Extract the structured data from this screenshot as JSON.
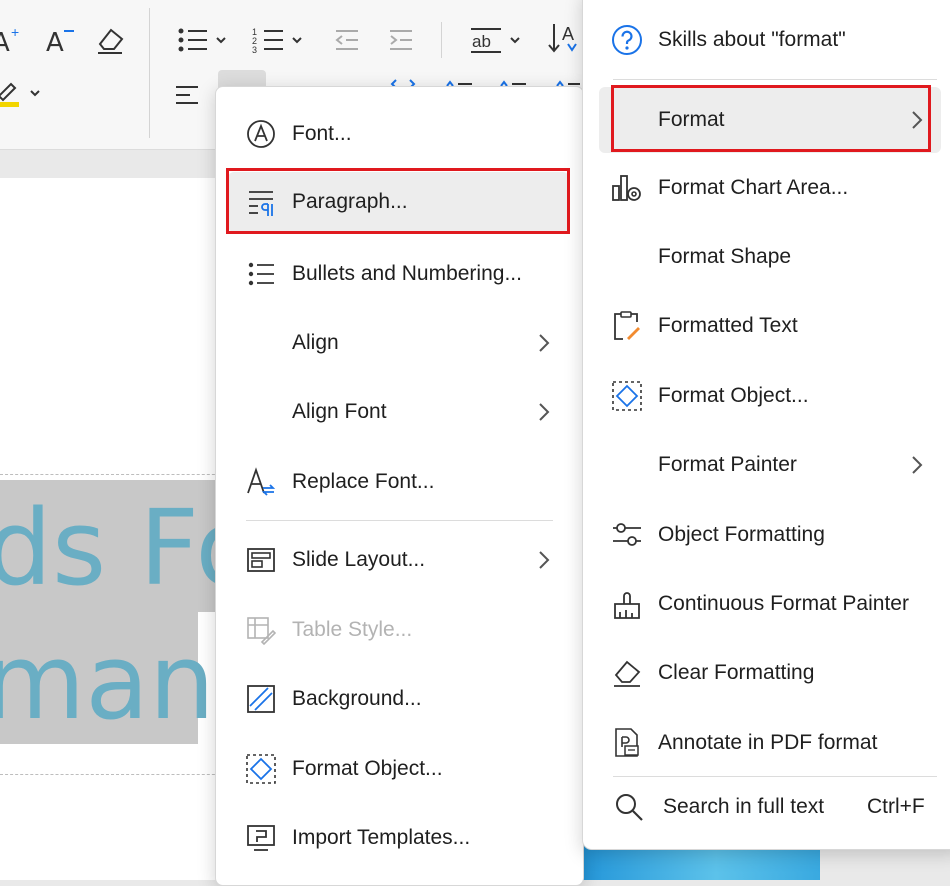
{
  "context_menu": {
    "items": [
      {
        "label": "Font...",
        "icon": "font-circle-icon"
      },
      {
        "label": "Paragraph...",
        "icon": "paragraph-icon",
        "highlighted": true
      },
      {
        "label": "Bullets and Numbering...",
        "icon": "bullets-list-icon"
      },
      {
        "label": "Align",
        "submenu": true
      },
      {
        "label": "Align Font",
        "submenu": true
      },
      {
        "label": "Replace Font...",
        "icon": "replace-font-icon"
      },
      {
        "label": "Slide Layout...",
        "icon": "slide-layout-icon",
        "submenu": true
      },
      {
        "label": "Table Style...",
        "icon": "table-style-icon",
        "disabled": true
      },
      {
        "label": "Background...",
        "icon": "background-icon"
      },
      {
        "label": "Format Object...",
        "icon": "format-object-icon"
      },
      {
        "label": "Import Templates...",
        "icon": "import-templates-icon"
      }
    ]
  },
  "skills_panel": {
    "header": "Skills about \"format\"",
    "items": [
      {
        "label": "Format",
        "submenu": true,
        "highlighted": true
      },
      {
        "label": "Format Chart Area...",
        "icon": "chart-area-icon"
      },
      {
        "label": "Format Shape"
      },
      {
        "label": "Formatted Text",
        "icon": "formatted-text-icon"
      },
      {
        "label": "Format Object...",
        "icon": "format-object-icon"
      },
      {
        "label": "Format Painter",
        "submenu": true
      },
      {
        "label": "Object Formatting",
        "icon": "object-formatting-icon"
      },
      {
        "label": "Continuous Format Painter",
        "icon": "format-painter-icon"
      },
      {
        "label": "Clear Formatting",
        "icon": "eraser-icon"
      },
      {
        "label": "Annotate in PDF format",
        "icon": "pdf-annotate-icon"
      }
    ],
    "search": {
      "label": "Search in full text",
      "shortcut": "Ctrl+F"
    }
  },
  "document": {
    "line1": "ds Fo",
    "line2": "man"
  },
  "colors": {
    "highlight_border": "#e0191e",
    "accent_blue": "#1a73e8",
    "doc_text": "#6aaec4"
  }
}
